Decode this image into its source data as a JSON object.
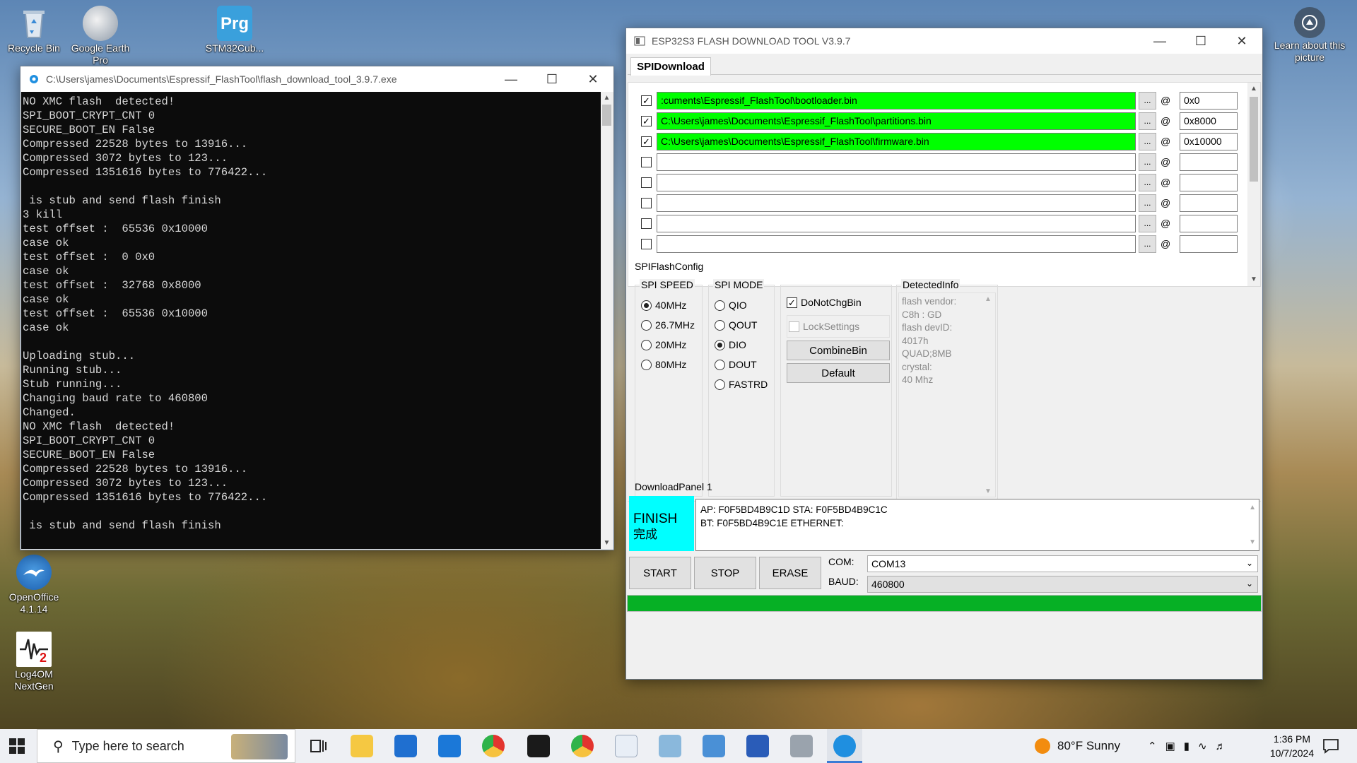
{
  "desktop": {
    "icons": [
      {
        "label": "Recycle Bin"
      },
      {
        "label": "Google Earth Pro"
      },
      {
        "label": "STM32Cub...",
        "glyph": "Prg"
      },
      {
        "label": "OpenOffice 4.1.14"
      },
      {
        "label": "Log4OM NextGen"
      }
    ],
    "learn_about": "Learn about this picture"
  },
  "console_window": {
    "title": "C:\\Users\\james\\Documents\\Espressif_FlashTool\\flash_download_tool_3.9.7.exe",
    "lines": [
      "NO XMC flash  detected!",
      "SPI_BOOT_CRYPT_CNT 0",
      "SECURE_BOOT_EN False",
      "Compressed 22528 bytes to 13916...",
      "Compressed 3072 bytes to 123...",
      "Compressed 1351616 bytes to 776422...",
      "",
      " is stub and send flash finish",
      "3 kill",
      "test offset :  65536 0x10000",
      "case ok",
      "test offset :  0 0x0",
      "case ok",
      "test offset :  32768 0x8000",
      "case ok",
      "test offset :  65536 0x10000",
      "case ok",
      "",
      "Uploading stub...",
      "Running stub...",
      "Stub running...",
      "Changing baud rate to 460800",
      "Changed.",
      "NO XMC flash  detected!",
      "SPI_BOOT_CRYPT_CNT 0",
      "SECURE_BOOT_EN False",
      "Compressed 22528 bytes to 13916...",
      "Compressed 3072 bytes to 123...",
      "Compressed 1351616 bytes to 776422...",
      "",
      " is stub and send flash finish"
    ]
  },
  "flash_tool": {
    "title": "ESP32S3 FLASH DOWNLOAD TOOL V3.9.7",
    "tab": "SPIDownload",
    "browse_label": "...",
    "at_label": "@",
    "files": [
      {
        "checked": true,
        "path": ":cuments\\Espressif_FlashTool\\bootloader.bin",
        "offset": "0x0"
      },
      {
        "checked": true,
        "path": "C:\\Users\\james\\Documents\\Espressif_FlashTool\\partitions.bin",
        "offset": "0x8000"
      },
      {
        "checked": true,
        "path": "C:\\Users\\james\\Documents\\Espressif_FlashTool\\firmware.bin",
        "offset": "0x10000"
      },
      {
        "checked": false,
        "path": "",
        "offset": ""
      },
      {
        "checked": false,
        "path": "",
        "offset": ""
      },
      {
        "checked": false,
        "path": "",
        "offset": ""
      },
      {
        "checked": false,
        "path": "",
        "offset": ""
      },
      {
        "checked": false,
        "path": "",
        "offset": ""
      }
    ],
    "spi_flash_config": "SPIFlashConfig",
    "spi_speed": {
      "label": "SPI SPEED",
      "options": [
        "40MHz",
        "26.7MHz",
        "20MHz",
        "80MHz"
      ],
      "selected": "40MHz"
    },
    "spi_mode": {
      "label": "SPI MODE",
      "options": [
        "QIO",
        "QOUT",
        "DIO",
        "DOUT",
        "FASTRD"
      ],
      "selected": "DIO"
    },
    "do_not_chg_bin": {
      "label": "DoNotChgBin",
      "checked": true
    },
    "lock_settings": {
      "label": "LockSettings",
      "checked": false
    },
    "combine_bin": "CombineBin",
    "default_btn": "Default",
    "detected_info": {
      "label": "DetectedInfo",
      "lines": [
        "flash vendor:",
        "C8h : GD",
        "flash devID:",
        "4017h",
        "QUAD;8MB",
        "crystal:",
        "40 Mhz"
      ]
    },
    "download_panel": "DownloadPanel 1",
    "status": {
      "text": "FINISH",
      "subtext": "完成"
    },
    "mac_lines": [
      "AP:  F0F5BD4B9C1D  STA:  F0F5BD4B9C1C",
      "BT:  F0F5BD4B9C1E  ETHERNET:"
    ],
    "start": "START",
    "stop": "STOP",
    "erase": "ERASE",
    "com_label": "COM:",
    "com_value": "COM13",
    "baud_label": "BAUD:",
    "baud_value": "460800",
    "progress": 1.0
  },
  "taskbar": {
    "search_placeholder": "Type here to search",
    "weather": "80°F  Sunny",
    "time": "1:36 PM",
    "date": "10/7/2024"
  },
  "colors": {
    "accent_green": "#00ff00",
    "progress_green": "#06b025",
    "finish_cyan": "#00ffff"
  }
}
